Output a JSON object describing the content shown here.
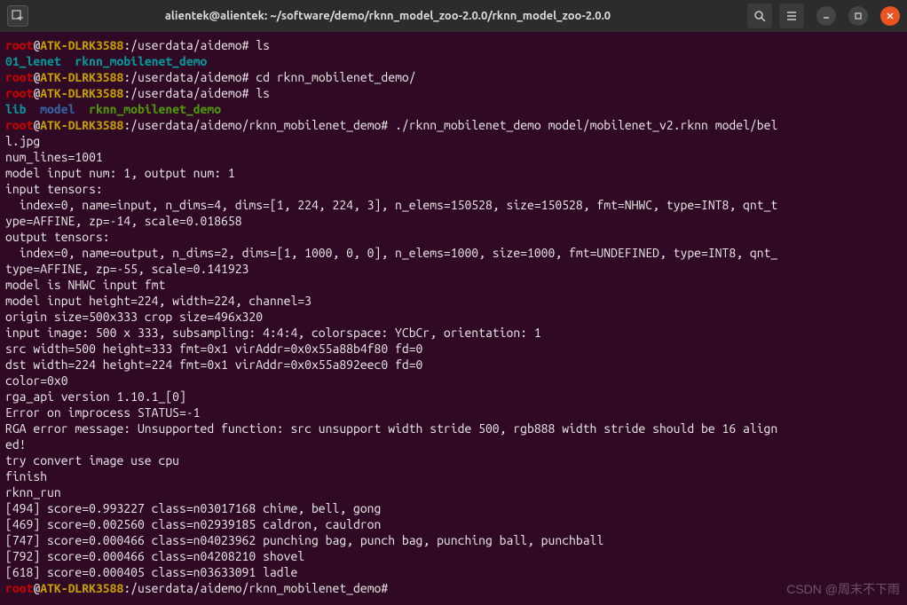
{
  "titlebar": {
    "title": "alientek@alientek: ~/software/demo/rknn_model_zoo-2.0.0/rknn_model_zoo-2.0.0"
  },
  "prompt": {
    "user": "root",
    "at": "@",
    "host": "ATK-DLRK3588",
    "colon": ":",
    "path1": "/userdata/aidemo",
    "path2": "/userdata/aidemo/rknn_mobilenet_demo",
    "hash": "# "
  },
  "cmd": {
    "ls1": "ls",
    "ls1_out1": "01_lenet",
    "ls1_out2": "rknn_mobilenet_demo",
    "cd": "cd rknn_mobilenet_demo/",
    "ls2": "ls",
    "ls2_out1": "lib",
    "ls2_out2": "model",
    "ls2_out3": "rknn_mobilenet_demo",
    "run": "./rknn_mobilenet_demo model/mobilenet_v2.rknn model/bel"
  },
  "out": {
    "l0": "l.jpg",
    "l1": "num_lines=1001",
    "l2": "model input num: 1, output num: 1",
    "l3": "input tensors:",
    "l4": "  index=0, name=input, n_dims=4, dims=[1, 224, 224, 3], n_elems=150528, size=150528, fmt=NHWC, type=INT8, qnt_t",
    "l5": "ype=AFFINE, zp=-14, scale=0.018658",
    "l6": "output tensors:",
    "l7": "  index=0, name=output, n_dims=2, dims=[1, 1000, 0, 0], n_elems=1000, size=1000, fmt=UNDEFINED, type=INT8, qnt_",
    "l8": "type=AFFINE, zp=-55, scale=0.141923",
    "l9": "model is NHWC input fmt",
    "l10": "model input height=224, width=224, channel=3",
    "l11": "origin size=500x333 crop size=496x320",
    "l12": "input image: 500 x 333, subsampling: 4:4:4, colorspace: YCbCr, orientation: 1",
    "l13": "src width=500 height=333 fmt=0x1 virAddr=0x0x55a88b4f80 fd=0",
    "l14": "dst width=224 height=224 fmt=0x1 virAddr=0x0x55a892eec0 fd=0",
    "l15": "color=0x0",
    "l16": "rga_api version 1.10.1_[0]",
    "l17": "Error on improcess STATUS=-1",
    "l18": "RGA error message: Unsupported function: src unsupport width stride 500, rgb888 width stride should be 16 align",
    "l19": "ed!",
    "l20": "try convert image use cpu",
    "l21": "finish",
    "l22": "rknn_run",
    "l23": "[494] score=0.993227 class=n03017168 chime, bell, gong",
    "l24": "[469] score=0.002560 class=n02939185 caldron, cauldron",
    "l25": "[747] score=0.000466 class=n04023962 punching bag, punch bag, punching ball, punchball",
    "l26": "[792] score=0.000466 class=n04208210 shovel",
    "l27": "[618] score=0.000405 class=n03633091 ladle"
  },
  "watermark": "CSDN @周末不下雨"
}
